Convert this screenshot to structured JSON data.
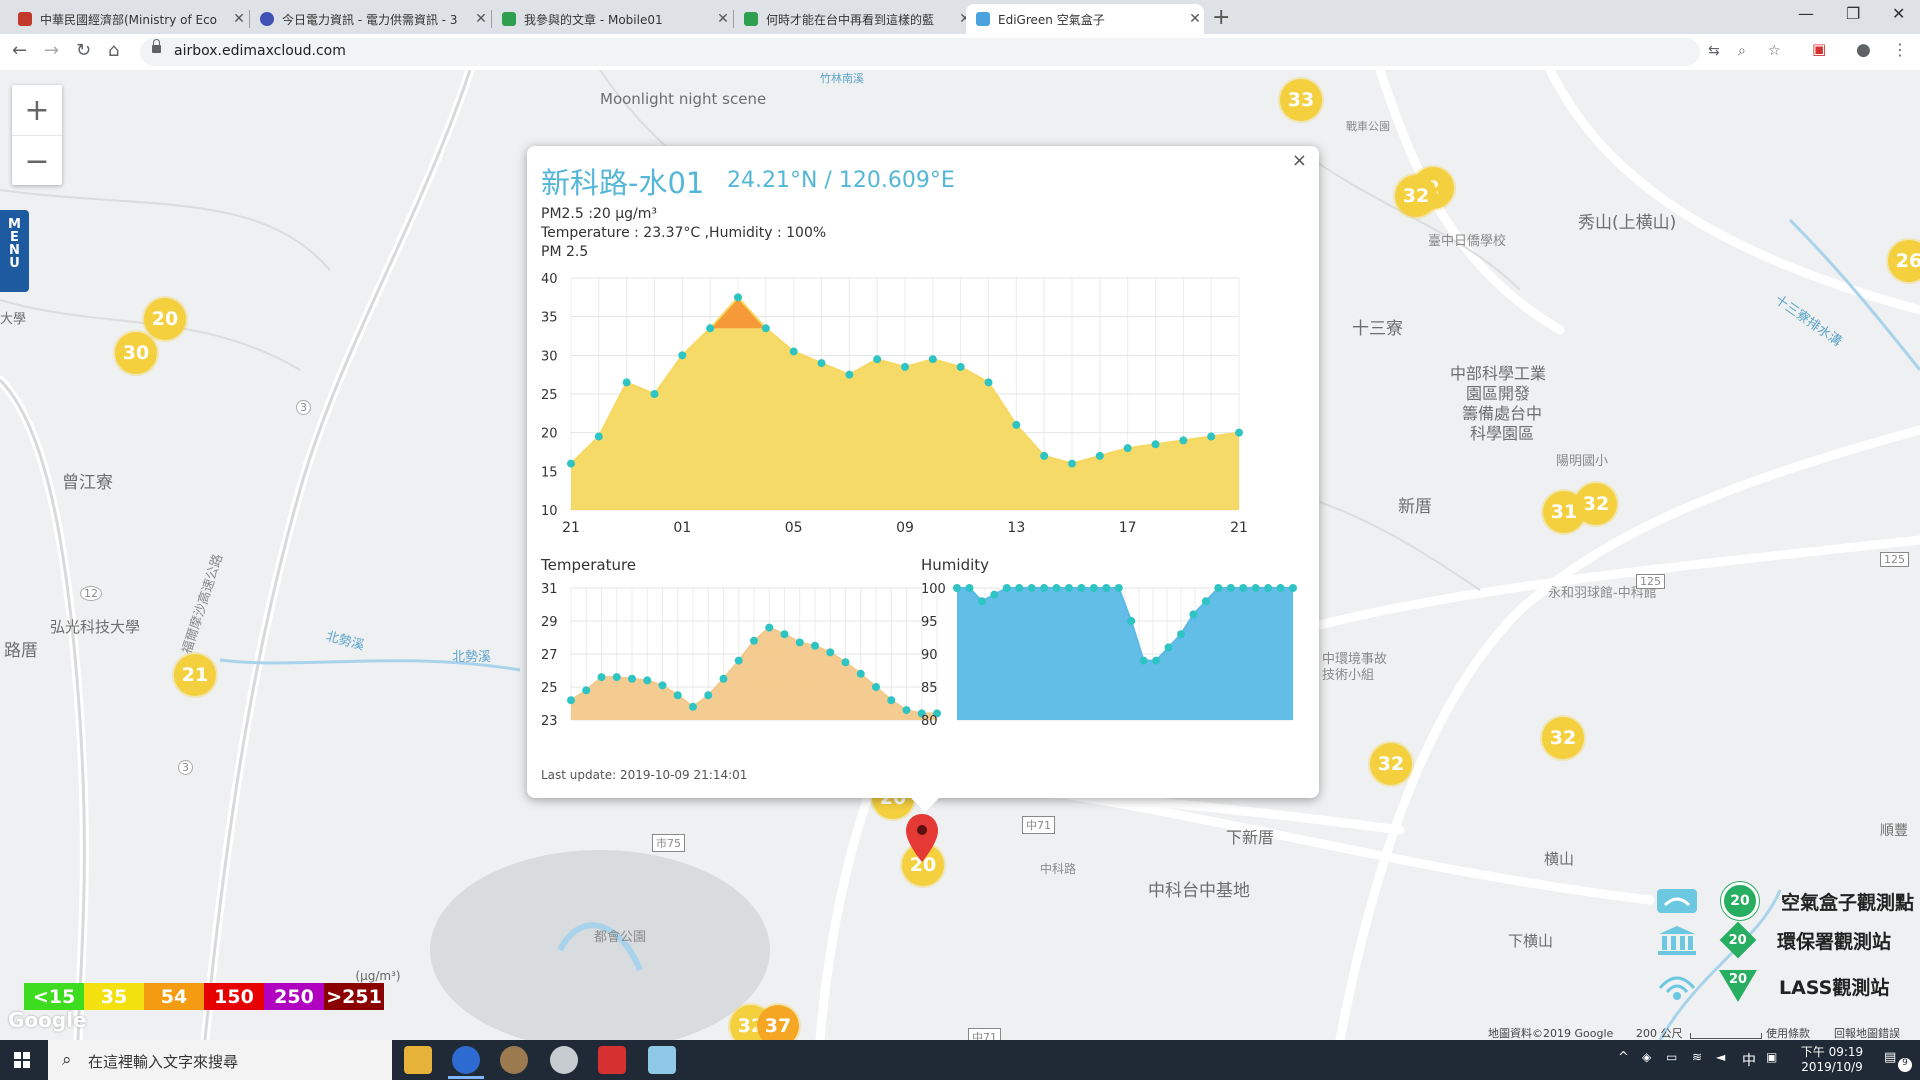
{
  "browser": {
    "tabs": [
      {
        "title": "中華民國經濟部(Ministry of Eco",
        "color": "#c0392b",
        "active": false
      },
      {
        "title": "今日電力資訊 - 電力供需資訊 - 3",
        "color": "#3f51b5",
        "active": false
      },
      {
        "title": "我參與的文章 - Mobile01",
        "color": "#2e9e4f",
        "active": false
      },
      {
        "title": "何時才能在台中再看到這樣的藍",
        "color": "#2e9e4f",
        "active": false
      },
      {
        "title": "EdiGreen 空氣盒子",
        "color": "#4aa3df",
        "active": true
      }
    ],
    "url": "airbox.edimaxcloud.com"
  },
  "map": {
    "labels": [
      {
        "text": "Moonlight night scene"
      },
      {
        "text": "竹林南溪"
      },
      {
        "text": "戰車公園"
      },
      {
        "text": "秀山(上横山)"
      },
      {
        "text": "臺中日僑學校"
      },
      {
        "text": "十三寮"
      },
      {
        "text": "中部科學工業"
      },
      {
        "text": "園區開發"
      },
      {
        "text": "籌備處台中"
      },
      {
        "text": "科學園區"
      },
      {
        "text": "陽明國小"
      },
      {
        "text": "新厝"
      },
      {
        "text": "十三寮排水溝"
      },
      {
        "text": "永和羽球館-中科館"
      },
      {
        "text": "中環境事故"
      },
      {
        "text": "技術小組"
      },
      {
        "text": "曾江寮"
      },
      {
        "text": "弘光科技大學"
      },
      {
        "text": "北勢溪"
      },
      {
        "text": "北勢溪"
      },
      {
        "text": "福爾摩沙高速公路"
      },
      {
        "text": "下新厝"
      },
      {
        "text": "中科台中基地"
      },
      {
        "text": "中科路"
      },
      {
        "text": "横山"
      },
      {
        "text": "下横山"
      },
      {
        "text": "都會公園"
      },
      {
        "text": "順豐"
      },
      {
        "text": "大學"
      },
      {
        "text": "路厝"
      }
    ],
    "clusters": [
      {
        "value": "33"
      },
      {
        "value": "32"
      },
      {
        "value": "2"
      },
      {
        "value": "20"
      },
      {
        "value": "30"
      },
      {
        "value": "31"
      },
      {
        "value": "32"
      },
      {
        "value": "21"
      },
      {
        "value": "32"
      },
      {
        "value": "32"
      },
      {
        "value": "20"
      },
      {
        "value": "20"
      },
      {
        "value": "32"
      },
      {
        "value": "37"
      },
      {
        "value": "26"
      }
    ],
    "zoom": {
      "plus": "+",
      "minus": "−"
    },
    "menu_label": [
      "M",
      "E",
      "N",
      "U"
    ],
    "pm_scale": {
      "unit": "(μg/m³)",
      "bands": [
        {
          "label": "<15",
          "color": "#3ddc1e"
        },
        {
          "label": "35",
          "color": "#f2e10f"
        },
        {
          "label": "54",
          "color": "#f39c12"
        },
        {
          "label": "150",
          "color": "#e60000"
        },
        {
          "label": "250",
          "color": "#b000c0"
        },
        {
          "label": ">251",
          "color": "#8b0000"
        }
      ]
    },
    "legend": {
      "airbox": {
        "badge": "20",
        "label": "空氣盒子觀測點"
      },
      "epa": {
        "badge": "20",
        "label": "環保署觀測站"
      },
      "lass": {
        "badge": "20",
        "label": "LASS觀測站"
      }
    },
    "attribution": {
      "data": "地圖資料©2019 Google",
      "scale": "200 公尺",
      "terms": "使用條款",
      "report": "回報地圖錯誤",
      "google": "Google"
    },
    "road_badges": [
      "3",
      "12",
      "3",
      "市75",
      "中71",
      "125",
      "125",
      "中71"
    ]
  },
  "popup": {
    "close": "×",
    "name": "新科路-水01",
    "coords": "24.21°N / 120.609°E",
    "pm_line": "PM2.5 :20 μg/m³",
    "temp_line": "Temperature : 23.37°C ,Humidity : 100%",
    "chart_title": "PM 2.5",
    "temp_title": "Temperature",
    "hum_title": "Humidity",
    "last_update": "Last update: 2019-10-09 21:14:01"
  },
  "chart_data": [
    {
      "type": "area",
      "title": "PM 2.5",
      "xticks": [
        "21",
        "01",
        "05",
        "09",
        "13",
        "17",
        "21"
      ],
      "yticks": [
        10,
        15,
        20,
        25,
        30,
        35,
        40
      ],
      "ylim": [
        10,
        40
      ],
      "x_hours": [
        0,
        1,
        2,
        3,
        4,
        5,
        6,
        7,
        8,
        9,
        10,
        11,
        12,
        13,
        14,
        15,
        16,
        17,
        18,
        19,
        20,
        21,
        22,
        23,
        24
      ],
      "values": [
        16,
        19.5,
        26.5,
        25,
        30,
        33.5,
        37.5,
        33.5,
        30.5,
        29,
        27.5,
        29.5,
        28.5,
        29.5,
        28.5,
        26.5,
        21,
        17,
        16,
        17,
        18,
        18.5,
        19,
        19.5,
        20
      ],
      "fill_color": "#f6d860",
      "highlight_color": "#f59a36",
      "highlight_above": 33.5,
      "point_color": "#2ec4c4"
    },
    {
      "type": "area",
      "title": "Temperature",
      "yticks": [
        23,
        25,
        27,
        29,
        31
      ],
      "ylim": [
        23,
        31
      ],
      "values": [
        24.2,
        24.8,
        25.6,
        25.6,
        25.5,
        25.4,
        25.1,
        24.5,
        23.8,
        24.5,
        25.5,
        26.6,
        27.8,
        28.6,
        28.2,
        27.7,
        27.5,
        27.1,
        26.5,
        25.8,
        25,
        24.2,
        23.6,
        23.4,
        23.4
      ],
      "fill_color": "#f3c98b",
      "point_color": "#2ec4c4"
    },
    {
      "type": "area",
      "title": "Humidity",
      "yticks": [
        80,
        85,
        90,
        95,
        100
      ],
      "ylim": [
        80,
        100
      ],
      "values": [
        100,
        100,
        98,
        99,
        100,
        100,
        100,
        100,
        100,
        100,
        100,
        100,
        100,
        100,
        95,
        89,
        89,
        91,
        93,
        96,
        98,
        100,
        100,
        100,
        100,
        100,
        100,
        100
      ],
      "fill_color": "#5ab9e6",
      "point_color": "#2ec4c4"
    }
  ],
  "taskbar": {
    "search_placeholder": "在這裡輸入文字來搜尋",
    "time": "下午 09:19",
    "date": "2019/10/9",
    "ime": "中",
    "notif": "9"
  }
}
